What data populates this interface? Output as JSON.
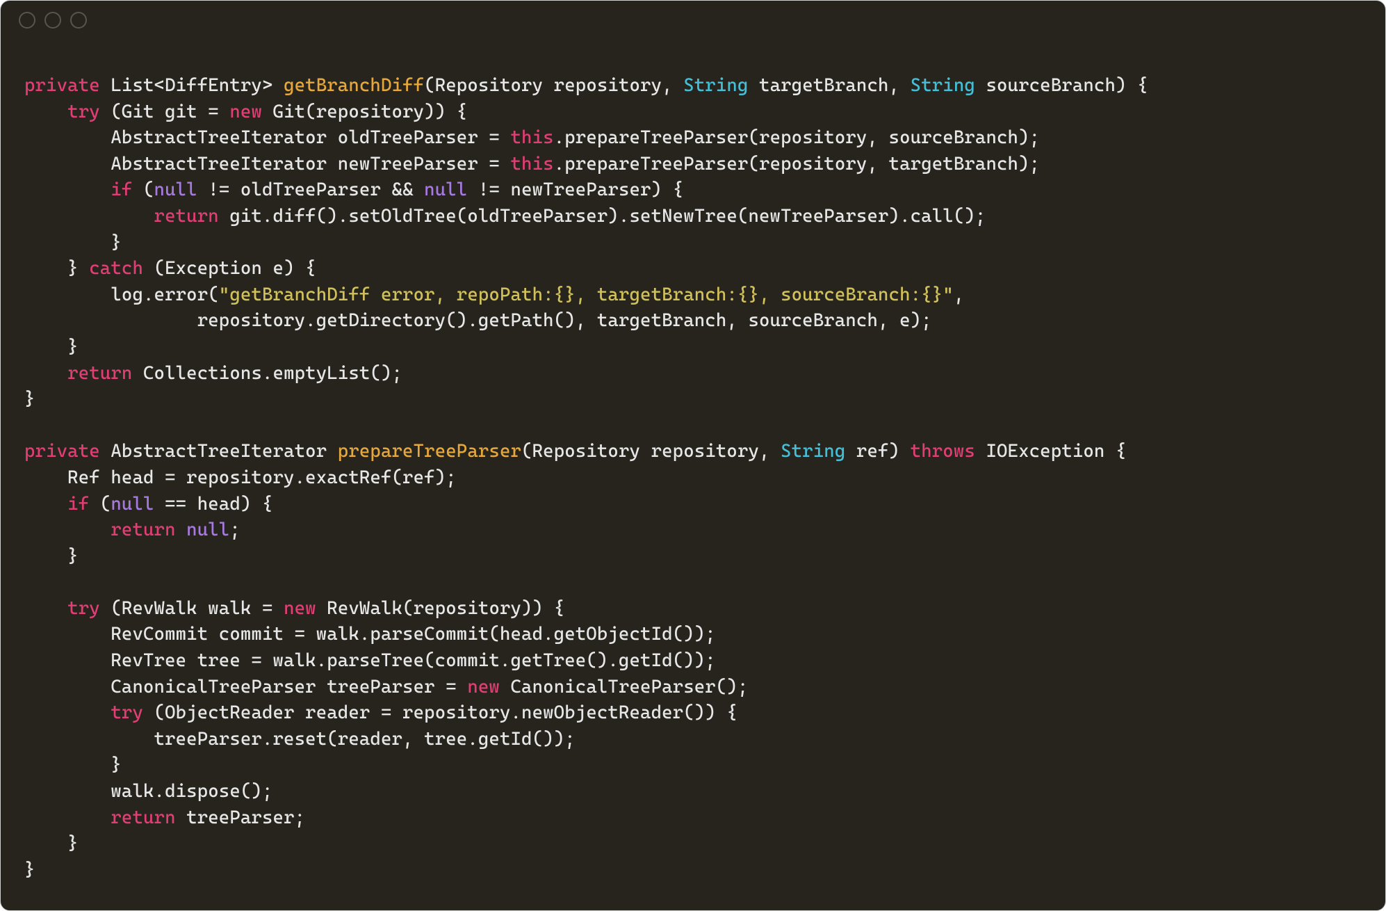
{
  "colors": {
    "background": "#26241d",
    "foreground": "#e7e7e7",
    "keyword": "#e03e75",
    "type": "#45bfd8",
    "method": "#e6a83c",
    "constant": "#a77ae0",
    "string": "#d1c15a",
    "trafficRing": "#57554e"
  },
  "code": {
    "lines": [
      [
        [
          "kw",
          "private"
        ],
        [
          "plain",
          " List<DiffEntry> "
        ],
        [
          "method",
          "getBranchDiff"
        ],
        [
          "plain",
          "(Repository repository, "
        ],
        [
          "type",
          "String"
        ],
        [
          "plain",
          " targetBranch, "
        ],
        [
          "type",
          "String"
        ],
        [
          "plain",
          " sourceBranch) {"
        ]
      ],
      [
        [
          "plain",
          "    "
        ],
        [
          "kw",
          "try"
        ],
        [
          "plain",
          " (Git git = "
        ],
        [
          "kw",
          "new"
        ],
        [
          "plain",
          " Git(repository)) {"
        ]
      ],
      [
        [
          "plain",
          "        AbstractTreeIterator oldTreeParser = "
        ],
        [
          "this",
          "this"
        ],
        [
          "plain",
          ".prepareTreeParser(repository, sourceBranch);"
        ]
      ],
      [
        [
          "plain",
          "        AbstractTreeIterator newTreeParser = "
        ],
        [
          "this",
          "this"
        ],
        [
          "plain",
          ".prepareTreeParser(repository, targetBranch);"
        ]
      ],
      [
        [
          "plain",
          "        "
        ],
        [
          "kw",
          "if"
        ],
        [
          "plain",
          " ("
        ],
        [
          "const",
          "null"
        ],
        [
          "plain",
          " != oldTreeParser && "
        ],
        [
          "const",
          "null"
        ],
        [
          "plain",
          " != newTreeParser) {"
        ]
      ],
      [
        [
          "plain",
          "            "
        ],
        [
          "kw",
          "return"
        ],
        [
          "plain",
          " git.diff().setOldTree(oldTreeParser).setNewTree(newTreeParser).call();"
        ]
      ],
      [
        [
          "plain",
          "        }"
        ]
      ],
      [
        [
          "plain",
          "    } "
        ],
        [
          "kw",
          "catch"
        ],
        [
          "plain",
          " (Exception e) {"
        ]
      ],
      [
        [
          "plain",
          "        log.error("
        ],
        [
          "str",
          "\"getBranchDiff error, repoPath:{}, targetBranch:{}, sourceBranch:{}\""
        ],
        [
          "plain",
          ","
        ]
      ],
      [
        [
          "plain",
          "                repository.getDirectory().getPath(), targetBranch, sourceBranch, e);"
        ]
      ],
      [
        [
          "plain",
          "    }"
        ]
      ],
      [
        [
          "plain",
          "    "
        ],
        [
          "kw",
          "return"
        ],
        [
          "plain",
          " Collections.emptyList();"
        ]
      ],
      [
        [
          "plain",
          "}"
        ]
      ],
      [
        [
          "plain",
          ""
        ]
      ],
      [
        [
          "kw",
          "private"
        ],
        [
          "plain",
          " AbstractTreeIterator "
        ],
        [
          "method",
          "prepareTreeParser"
        ],
        [
          "plain",
          "(Repository repository, "
        ],
        [
          "type",
          "String"
        ],
        [
          "plain",
          " ref) "
        ],
        [
          "kw",
          "throws"
        ],
        [
          "plain",
          " IOException {"
        ]
      ],
      [
        [
          "plain",
          "    Ref head = repository.exactRef(ref);"
        ]
      ],
      [
        [
          "plain",
          "    "
        ],
        [
          "kw",
          "if"
        ],
        [
          "plain",
          " ("
        ],
        [
          "const",
          "null"
        ],
        [
          "plain",
          " == head) {"
        ]
      ],
      [
        [
          "plain",
          "        "
        ],
        [
          "kw",
          "return"
        ],
        [
          "plain",
          " "
        ],
        [
          "const",
          "null"
        ],
        [
          "plain",
          ";"
        ]
      ],
      [
        [
          "plain",
          "    }"
        ]
      ],
      [
        [
          "plain",
          ""
        ]
      ],
      [
        [
          "plain",
          "    "
        ],
        [
          "kw",
          "try"
        ],
        [
          "plain",
          " (RevWalk walk = "
        ],
        [
          "kw",
          "new"
        ],
        [
          "plain",
          " RevWalk(repository)) {"
        ]
      ],
      [
        [
          "plain",
          "        RevCommit commit = walk.parseCommit(head.getObjectId());"
        ]
      ],
      [
        [
          "plain",
          "        RevTree tree = walk.parseTree(commit.getTree().getId());"
        ]
      ],
      [
        [
          "plain",
          "        CanonicalTreeParser treeParser = "
        ],
        [
          "kw",
          "new"
        ],
        [
          "plain",
          " CanonicalTreeParser();"
        ]
      ],
      [
        [
          "plain",
          "        "
        ],
        [
          "kw",
          "try"
        ],
        [
          "plain",
          " (ObjectReader reader = repository.newObjectReader()) {"
        ]
      ],
      [
        [
          "plain",
          "            treeParser.reset(reader, tree.getId());"
        ]
      ],
      [
        [
          "plain",
          "        }"
        ]
      ],
      [
        [
          "plain",
          "        walk.dispose();"
        ]
      ],
      [
        [
          "plain",
          "        "
        ],
        [
          "kw",
          "return"
        ],
        [
          "plain",
          " treeParser;"
        ]
      ],
      [
        [
          "plain",
          "    }"
        ]
      ],
      [
        [
          "plain",
          "}"
        ]
      ]
    ]
  }
}
